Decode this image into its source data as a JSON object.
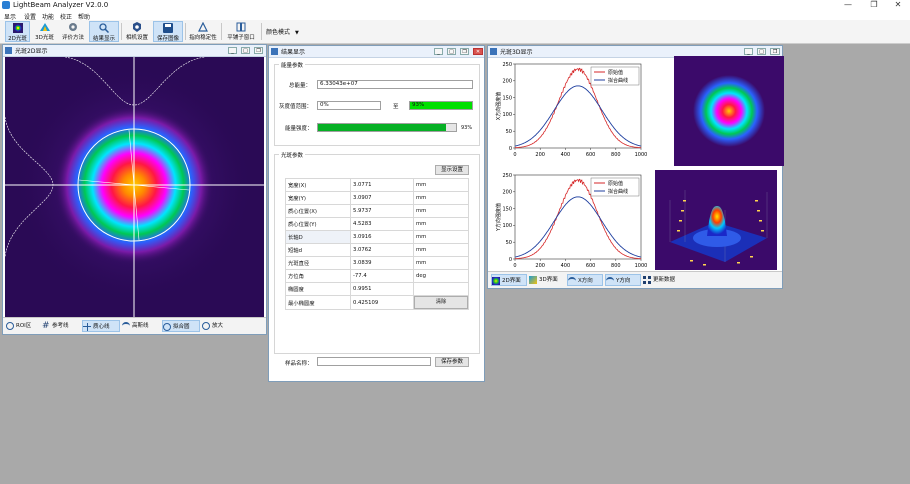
{
  "app": {
    "title": "LightBeam Analyzer V2.0.0",
    "min": "—",
    "max": "❐",
    "close": "✕"
  },
  "menu": [
    "显示",
    "设置",
    "功能",
    "校正",
    "帮助"
  ],
  "toolbar": {
    "items": [
      "2D光斑",
      "3D光斑",
      "评价方法",
      "结果显示",
      "相机设置",
      "保存图像",
      "指向稳定性",
      "平铺子窗口"
    ],
    "color_mode": "颜色模式"
  },
  "win2d": {
    "title": "光斑2D显示",
    "bottom": [
      "ROI区",
      "参考线",
      "质心线",
      "高斯线",
      "拟合圆",
      "放大"
    ]
  },
  "result": {
    "title": "结果显示",
    "energy_group": "能量参数",
    "total_energy_label": "总能量：",
    "total_energy_value": "6.33043e+07",
    "gray_range_label": "灰度值范围：",
    "gray_min": "0%",
    "gray_to": "至",
    "gray_max": "93%",
    "uniformity_label": "能量强度：",
    "uniformity_value": 0.93,
    "uniformity_text": "93%",
    "beam_group": "光斑参数",
    "show_settings": "显示设置",
    "rows": [
      {
        "name": "宽度(X)",
        "value": "3.0771",
        "unit": "mm"
      },
      {
        "name": "宽度(Y)",
        "value": "3.0907",
        "unit": "mm"
      },
      {
        "name": "质心位置(X)",
        "value": "5.9737",
        "unit": "mm"
      },
      {
        "name": "质心位置(Y)",
        "value": "4.5283",
        "unit": "mm"
      },
      {
        "name": "长轴D",
        "value": "3.0916",
        "unit": "mm"
      },
      {
        "name": "短轴d",
        "value": "3.0762",
        "unit": "mm"
      },
      {
        "name": "光斑直径",
        "value": "3.0839",
        "unit": "mm"
      },
      {
        "name": "方位角",
        "value": "-77.4",
        "unit": "deg"
      },
      {
        "name": "椭圆度",
        "value": "0.9951",
        "unit": ""
      },
      {
        "name": "最小椭圆度",
        "value": "0.425109",
        "unit": ""
      }
    ],
    "clear_button": "清除",
    "sample_name_label": "样品名称：",
    "sample_name_value": "",
    "save_params": "保存参数"
  },
  "win3d": {
    "title": "光斑3D显示",
    "bottom": [
      "2D界面",
      "3D界面",
      "X方向",
      "Y方向",
      "更新数据"
    ]
  },
  "chart_data": [
    {
      "type": "line",
      "title": "",
      "xlabel": "",
      "ylabel": "X方向强度值",
      "xlim": [
        0,
        1000
      ],
      "ylim": [
        0,
        250
      ],
      "xticks": [
        0,
        200,
        400,
        600,
        800,
        1000
      ],
      "yticks": [
        0,
        50,
        100,
        150,
        200,
        250
      ],
      "legend": "top-right",
      "series": [
        {
          "name": "原始值",
          "color": "#d62728",
          "kind": "measured",
          "peak": 235,
          "center": 500,
          "sigma": 150
        },
        {
          "name": "拟合曲线",
          "color": "#1f3f9f",
          "kind": "fit",
          "peak": 185,
          "center": 500,
          "sigma": 190
        }
      ]
    },
    {
      "type": "line",
      "title": "",
      "xlabel": "",
      "ylabel": "Y方向强度值",
      "xlim": [
        0,
        1000
      ],
      "ylim": [
        0,
        250
      ],
      "xticks": [
        0,
        200,
        400,
        600,
        800,
        1000
      ],
      "yticks": [
        0,
        50,
        100,
        150,
        200,
        250
      ],
      "legend": "top-right",
      "series": [
        {
          "name": "原始值",
          "color": "#d62728",
          "kind": "measured",
          "peak": 235,
          "center": 500,
          "sigma": 150
        },
        {
          "name": "拟合曲线",
          "color": "#1f3f9f",
          "kind": "fit",
          "peak": 185,
          "center": 500,
          "sigma": 190
        }
      ]
    }
  ]
}
